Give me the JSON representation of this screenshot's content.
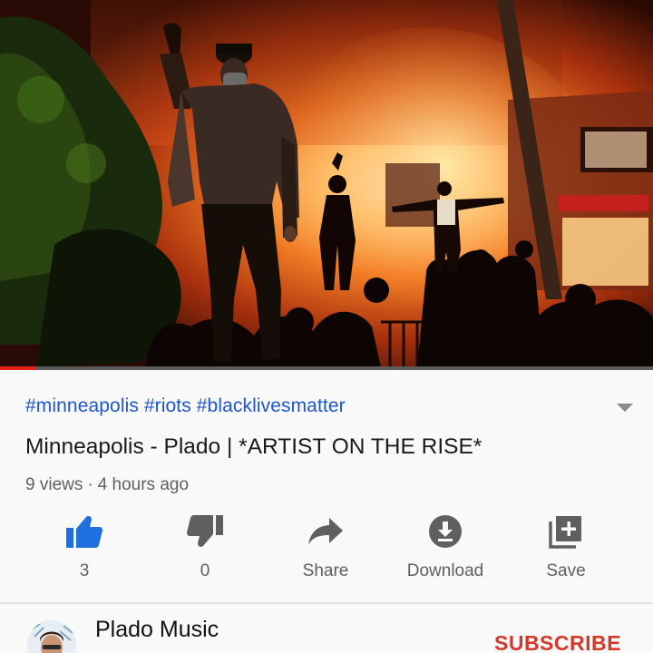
{
  "video": {
    "description": "",
    "progress_fraction": 0.055
  },
  "hashtags": "#minneapolis #riots #blacklivesmatter",
  "title": "Minneapolis - Plado | *ARTIST ON THE RISE*",
  "meta": {
    "views": "9 views",
    "separator": "·",
    "age": "4 hours ago"
  },
  "actions": [
    {
      "icon": "thumbs-up-icon",
      "label": "3",
      "active": true
    },
    {
      "icon": "thumbs-down-icon",
      "label": "0",
      "active": false
    },
    {
      "icon": "share-icon",
      "label": "Share",
      "active": false
    },
    {
      "icon": "download-icon",
      "label": "Download",
      "active": false
    },
    {
      "icon": "save-icon",
      "label": "Save",
      "active": false
    }
  ],
  "channel": {
    "name": "Plado Music",
    "subscribers": "",
    "subscribe_label": "SUBSCRIBE"
  },
  "colors": {
    "accent_blue": "#1f56c9",
    "like_active": "#1f6fe0",
    "subscribe_red": "#d33a2b",
    "progress_red": "#e52117"
  }
}
